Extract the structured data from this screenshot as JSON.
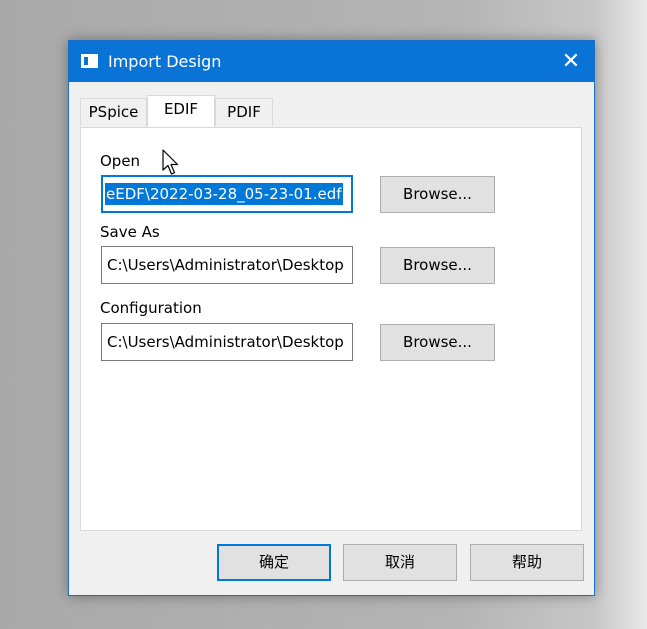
{
  "dialog": {
    "title": "Import Design",
    "close_glyph": "✕",
    "icon": "window-icon"
  },
  "tabs": [
    {
      "label": "PSpice",
      "active": false
    },
    {
      "label": "EDIF",
      "active": true
    },
    {
      "label": "PDIF",
      "active": false
    }
  ],
  "open": {
    "label": "Open",
    "value": "eEDF\\2022-03-28_05-23-01.edf",
    "browse_label": "Browse..."
  },
  "save_as": {
    "label": "Save As",
    "value": "C:\\Users\\Administrator\\Desktop",
    "browse_label": "Browse..."
  },
  "configuration": {
    "label": "Configuration",
    "value": "C:\\Users\\Administrator\\Desktop",
    "browse_label": "Browse..."
  },
  "footer": {
    "ok_label": "确定",
    "cancel_label": "取消",
    "help_label": "帮助"
  },
  "colors": {
    "titlebar": "#0a74d6",
    "selection": "#0078d7"
  }
}
